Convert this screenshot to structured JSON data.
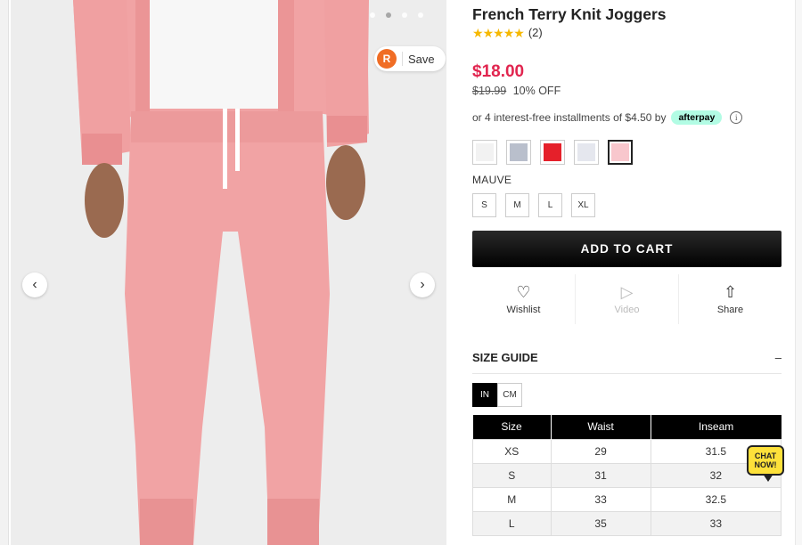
{
  "product": {
    "title": "French Terry Knit Joggers",
    "rating_stars": 5,
    "review_count": "(2)",
    "price": "$18.00",
    "original_price": "$19.99",
    "discount": "10% OFF",
    "installments_text": "or 4 interest-free installments of $4.50 by",
    "afterpay_label": "afterpay",
    "selected_color": "MAUVE",
    "swatches": [
      "#f2f2f2",
      "#b9bfcc",
      "#e5202a",
      "#e5e7ee",
      "#f8c7cd"
    ],
    "sizes": [
      "S",
      "M",
      "L",
      "XL"
    ],
    "add_to_cart": "ADD TO CART"
  },
  "actions": {
    "wishlist": "Wishlist",
    "video": "Video",
    "share": "Share"
  },
  "gallery": {
    "save_label": "Save",
    "save_logo": "R",
    "dot_count": 4,
    "active_dot": 1
  },
  "size_guide": {
    "title": "SIZE GUIDE",
    "collapse": "–",
    "units": [
      "IN",
      "CM"
    ],
    "headers": [
      "Size",
      "Waist",
      "Inseam"
    ],
    "rows": [
      [
        "XS",
        "29",
        "31.5"
      ],
      [
        "S",
        "31",
        "32"
      ],
      [
        "M",
        "33",
        "32.5"
      ],
      [
        "L",
        "35",
        "33"
      ]
    ]
  },
  "chat": {
    "line1": "CHAT",
    "line2": "NOW!"
  },
  "colors": {
    "price": "#e1254f",
    "afterpay": "#b2fce4",
    "star": "#f6b800",
    "jogger_pink": "#f1a3a4"
  }
}
